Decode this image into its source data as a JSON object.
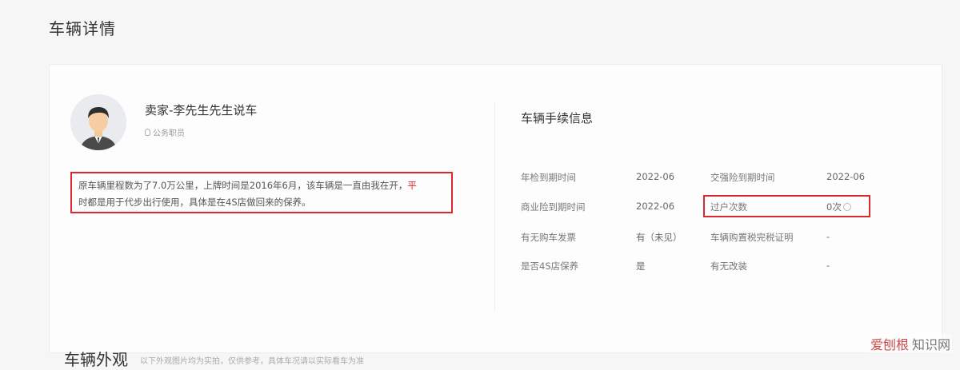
{
  "page": {
    "title": "车辆详情"
  },
  "seller": {
    "name": "卖家-李先生先生说车",
    "tag": "公务职员",
    "description_line1_main": "原车辆里程数为了7.0万公里，上牌时间是2016年6月，该车辆是一直由我在开，",
    "description_line1_red": "平",
    "description_line2": "时都是用于代步出行使用，具体是在4S店做回来的保养。"
  },
  "procedures": {
    "title": "车辆手续信息",
    "rows": [
      {
        "label1": "年检到期时间",
        "value1": "2022-06",
        "label2": "交强险到期时间",
        "value2": "2022-06"
      },
      {
        "label1": "商业险到期时间",
        "value1": "2022-06",
        "label2": "过户次数",
        "value2": "0次"
      },
      {
        "label1": "有无购车发票",
        "value1": "有（未见）",
        "label2": "车辆购置税完税证明",
        "value2": "-"
      },
      {
        "label1": "是否4S店保养",
        "value1": "是",
        "label2": "有无改装",
        "value2": "-"
      }
    ]
  },
  "bottom": {
    "title": "车辆外观",
    "subtitle": "以下外观图片均为实拍，仅供参考，具体车况请以实际看车为准"
  },
  "watermark": {
    "text_brand": "爱刨根",
    "text_rest": "知识网"
  }
}
